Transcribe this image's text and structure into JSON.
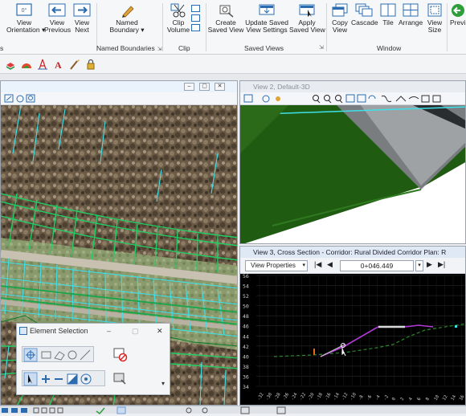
{
  "ribbon": {
    "buttons": {
      "view_orientation": "View\nOrientation ▾",
      "view_previous": "View\nPrevious",
      "view_next": "View\nNext",
      "named_boundary": "Named\nBoundary ▾",
      "clip_volume": "Clip\nVolume",
      "create_saved_view": "Create\nSaved View",
      "update_saved_view": "Update Saved\nView Settings",
      "apply_saved_view": "Apply\nSaved View",
      "copy_view": "Copy\nView",
      "cascade": "Cascade",
      "tile": "Tile",
      "arrange": "Arrange",
      "view_size": "View\nSize",
      "previous": "Previ"
    },
    "groups": {
      "views_partial": "s",
      "named_boundaries": "Named Boundaries",
      "clip": "Clip",
      "saved_views": "Saved Views",
      "window": "Window"
    }
  },
  "view2": {
    "title": "View 2, Default-3D"
  },
  "view3": {
    "title": "View 3, Cross Section - Corridor: Rural Divided Corridor Plan: R",
    "properties_label": "View Properties",
    "station_value": "0+046.449",
    "y_ticks": [
      "56",
      "54",
      "52",
      "50",
      "48",
      "46",
      "44",
      "42",
      "40",
      "38",
      "36",
      "34"
    ],
    "x_ticks": [
      "-32",
      "-30",
      "-28",
      "-26",
      "-24",
      "-22",
      "-20",
      "-18",
      "-16",
      "-14",
      "-12",
      "-10",
      "-8",
      "-6",
      "-4",
      "-2",
      "0",
      "2",
      "4",
      "6",
      "8",
      "10",
      "12",
      "14",
      "16"
    ]
  },
  "element_selection": {
    "title": "Element Selection"
  },
  "colors": {
    "accent": "#2b6cb0",
    "green_linework": "#1fcf63",
    "cyan_linework": "#3fe0e8",
    "terrain": "#1f5c12"
  }
}
